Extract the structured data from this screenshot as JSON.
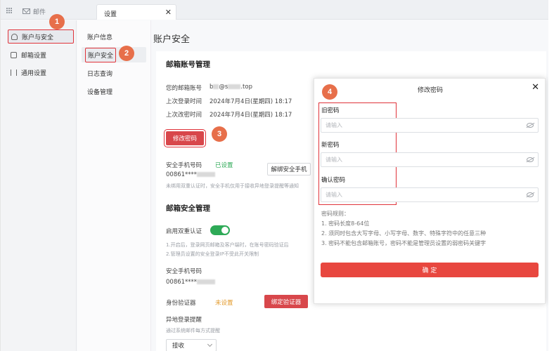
{
  "topbar": {
    "app_label": "邮件",
    "tab_label": "设置",
    "tab_close": "✕"
  },
  "sidebar": {
    "items": [
      {
        "label": "账户与安全",
        "icon": "user-icon"
      },
      {
        "label": "邮箱设置",
        "icon": "mailbox-icon"
      },
      {
        "label": "通用设置",
        "icon": "sliders-icon"
      }
    ]
  },
  "subnav": {
    "items": [
      {
        "label": "账户信息"
      },
      {
        "label": "账户安全"
      },
      {
        "label": "日志查询"
      },
      {
        "label": "设备管理"
      }
    ]
  },
  "main": {
    "title": "账户安全",
    "mailbox_section": {
      "title": "邮箱账号管理",
      "email_label": "您的邮箱账号",
      "email_value_prefix": "b",
      "email_value_mid": "@s",
      "email_value_suffix": ".top",
      "last_login_label": "上次登录时间",
      "last_login_value": "2024年7月4日(星期四) 18:17",
      "last_change_label": "上次改密时间",
      "last_change_value": "2024年7月4日(星期四) 18:17",
      "change_password_button": "修改密码",
      "phone_label": "安全手机号码",
      "phone_status": "已设置",
      "phone_value": "00861****",
      "unbind_phone_button": "解绑安全手机",
      "phone_note": "未绑用双重认证时，安全手机仅用于接收异地登录提醒等通知"
    },
    "security_section": {
      "title": "邮箱安全管理",
      "two_factor_label": "启用双重认证",
      "two_factor_note_1": "1.开启后，登录网页邮箱及客户端时，在账号密码验证后",
      "two_factor_note_2": "2.管理员设置的安全登录IP不受此开关限制",
      "phone_label": "安全手机号码",
      "phone_value": "00861****",
      "authenticator_label": "身份验证器",
      "authenticator_status": "未设置",
      "bind_authenticator_button": "绑定验证器",
      "remote_login_label": "异地登录提醒",
      "remote_login_note": "通过系统邮件每方式提醒",
      "remote_login_select": "接收"
    }
  },
  "modal": {
    "title": "修改密码",
    "close": "✕",
    "old_password_label": "旧密码",
    "new_password_label": "新密码",
    "confirm_password_label": "确认密码",
    "placeholder": "请输入",
    "rules_title": "密码规则：",
    "rule_1": "1. 密码长度8-64位",
    "rule_2": "2. 须同时包含大写字母、小写字母、数字、特殊字符中的任意三种",
    "rule_3": "3. 密码不能包含邮箱账号，密码不能是管理员设置的弱密码关键字",
    "confirm_button": "确 定"
  },
  "badges": {
    "step1": "1",
    "step2": "2",
    "step3": "3",
    "step4": "4"
  },
  "colors": {
    "accent_red": "#e8473f",
    "badge_orange": "#e76f4a",
    "success_green": "#2eaa57",
    "warning_orange": "#e39a2b"
  }
}
